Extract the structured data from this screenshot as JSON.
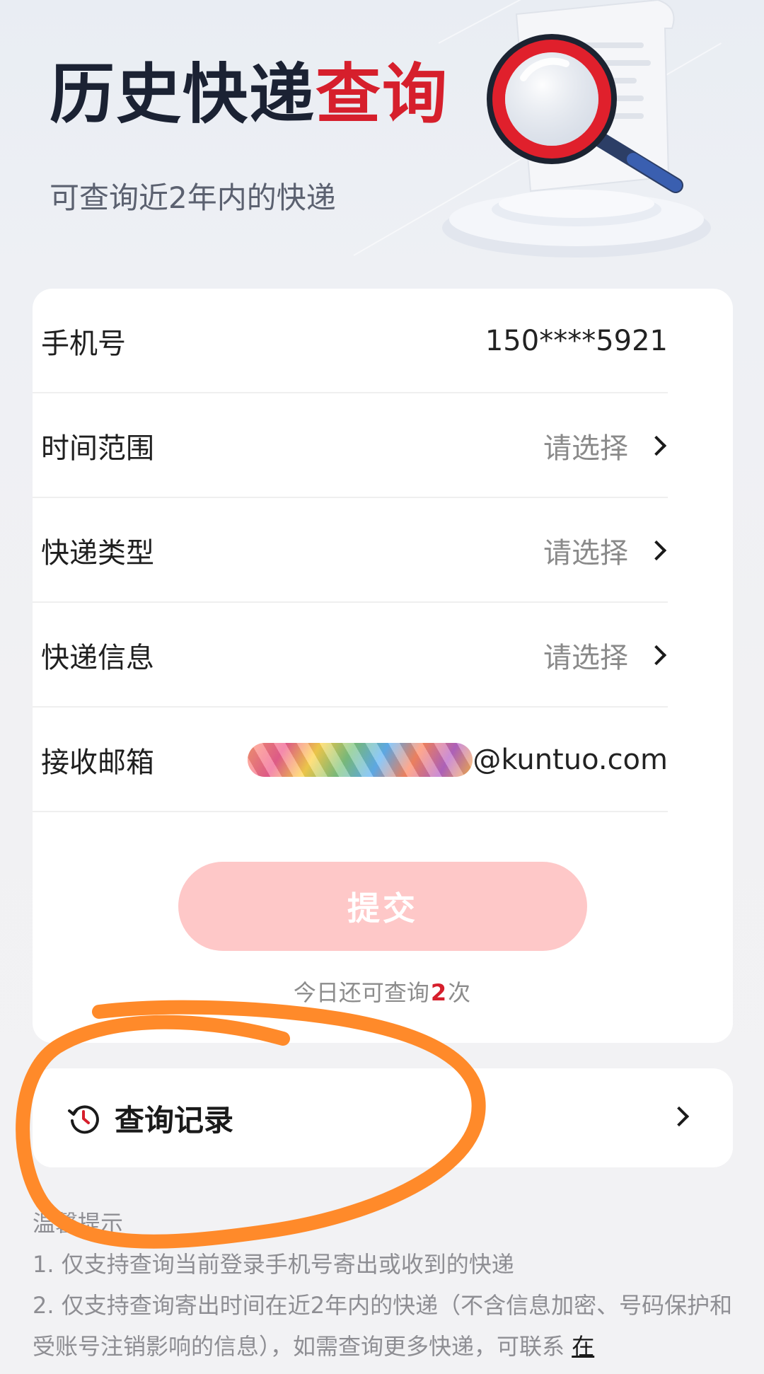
{
  "hero": {
    "title_part1": "历史快递",
    "title_part2": "查询",
    "subtitle": "可查询近2年内的快递"
  },
  "form": {
    "phone": {
      "label": "手机号",
      "value": "150****5921"
    },
    "time_range": {
      "label": "时间范围",
      "value": "请选择"
    },
    "express_type": {
      "label": "快递类型",
      "value": "请选择"
    },
    "express_info": {
      "label": "快递信息",
      "value": "请选择"
    },
    "email": {
      "label": "接收邮箱",
      "value_suffix": "@kuntuo.com"
    }
  },
  "submit": {
    "label": "提交",
    "remaining_prefix": "今日还可查询",
    "remaining_count": "2",
    "remaining_suffix": "次"
  },
  "history": {
    "label": "查询记录"
  },
  "tips": {
    "title": "温馨提示",
    "item1": "1. 仅支持查询当前登录手机号寄出或收到的快递",
    "item2": "2. 仅支持查询寄出时间在近2年内的快递（不含信息加密、号码保护和受账号注销影响的信息），如需查询更多快递，可联系",
    "item2_link": "在"
  },
  "colors": {
    "accent_red": "#d61f2c",
    "submit_disabled": "#fec8c8",
    "annotation_orange": "#ff8a2a"
  },
  "icons": [
    "magnifier-document-illustration",
    "chevron-right-icon",
    "history-clock-icon"
  ]
}
